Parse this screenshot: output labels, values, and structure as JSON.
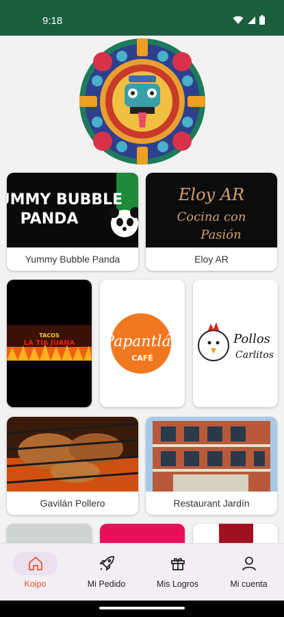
{
  "status_bar": {
    "time": "9:18"
  },
  "header": {
    "logo_icon": "aztec-calendar-logo"
  },
  "restaurants": {
    "yummy": {
      "name": "Yummy Bubble Panda",
      "logo_text_line1": "YUMMY BUBBLE",
      "logo_text_line2": "PANDA"
    },
    "eloy": {
      "name": "Eloy AR",
      "logo_text_line1": "Eloy AR",
      "logo_text_line2": "Cocina con",
      "logo_text_line3": "Pasión"
    },
    "tacos": {
      "logo_text_line1": "TACOS",
      "logo_text_line2": "LA TÍA JUANA"
    },
    "papantlan": {
      "logo_text_line1": "Papantlán",
      "logo_text_line2": "CAFÉ"
    },
    "pollos": {
      "logo_text_line1": "Pollos",
      "logo_text_line2": "Carlitos"
    },
    "gavilan": {
      "name": "Gavilán Pollero"
    },
    "jardin": {
      "name": "Restaurant Jardín"
    }
  },
  "nav": {
    "active_color": "#e8562a",
    "items": [
      {
        "label": "Koipo",
        "icon": "home-icon"
      },
      {
        "label": "Mi Pedido",
        "icon": "rocket-icon"
      },
      {
        "label": "Mis Logros",
        "icon": "gift-icon"
      },
      {
        "label": "Mi cuenta",
        "icon": "person-icon"
      }
    ]
  }
}
